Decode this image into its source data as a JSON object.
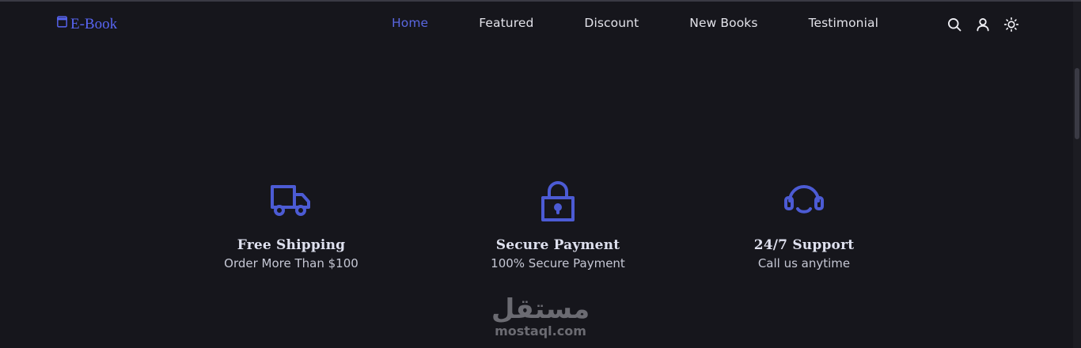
{
  "brand": {
    "name": "E-Book",
    "icon": "book-icon",
    "color": "#5865f2"
  },
  "nav": {
    "items": [
      {
        "label": "Home",
        "active": true
      },
      {
        "label": "Featured",
        "active": false
      },
      {
        "label": "Discount",
        "active": false
      },
      {
        "label": "New Books",
        "active": false
      },
      {
        "label": "Testimonial",
        "active": false
      }
    ],
    "active_color": "#5a67e0"
  },
  "header_icons": [
    "search-icon",
    "user-icon",
    "sun-icon"
  ],
  "features": [
    {
      "icon": "truck-icon",
      "title": "Free Shipping",
      "subtitle": "Order More Than $100"
    },
    {
      "icon": "lock-icon",
      "title": "Secure Payment",
      "subtitle": "100% Secure Payment"
    },
    {
      "icon": "headset-icon",
      "title": "24/7 Support",
      "subtitle": "Call us anytime"
    }
  ],
  "watermark": {
    "arabic": "مستقل",
    "latin": "mostaql.com"
  },
  "colors": {
    "background": "#16161c",
    "accent": "#4c5bd4"
  }
}
